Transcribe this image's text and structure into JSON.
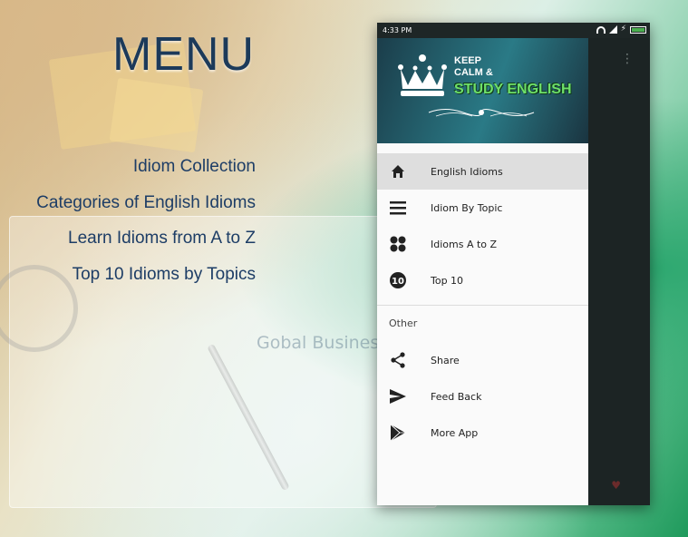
{
  "promo": {
    "heading": "MENU",
    "features": [
      "Idiom Collection",
      "Categories of English Idioms",
      "Learn Idioms from A to Z",
      "Top 10 Idioms by Topics"
    ],
    "background_text": "Gobal Business"
  },
  "status_bar": {
    "time": "4:33 PM"
  },
  "drawer": {
    "header": {
      "line1": "KEEP",
      "line2": "CALM &",
      "line3": "STUDY ENGLISH"
    },
    "items": [
      {
        "label": "English Idioms",
        "icon": "home-icon",
        "active": true
      },
      {
        "label": "Idiom By Topic",
        "icon": "menu-lines-icon",
        "active": false
      },
      {
        "label": "Idioms A to Z",
        "icon": "grid-dots-icon",
        "active": false
      },
      {
        "label": "Top 10",
        "icon": "top10-icon",
        "active": false
      }
    ],
    "other_section_title": "Other",
    "other_items": [
      {
        "label": "Share",
        "icon": "share-icon"
      },
      {
        "label": "Feed Back",
        "icon": "send-icon"
      },
      {
        "label": "More App",
        "icon": "play-store-icon"
      }
    ]
  },
  "colors": {
    "heading": "#1c3a5a",
    "feature_text": "#1d3d66",
    "header_accent": "#6ee06a",
    "active_item_bg": "#dedede"
  }
}
